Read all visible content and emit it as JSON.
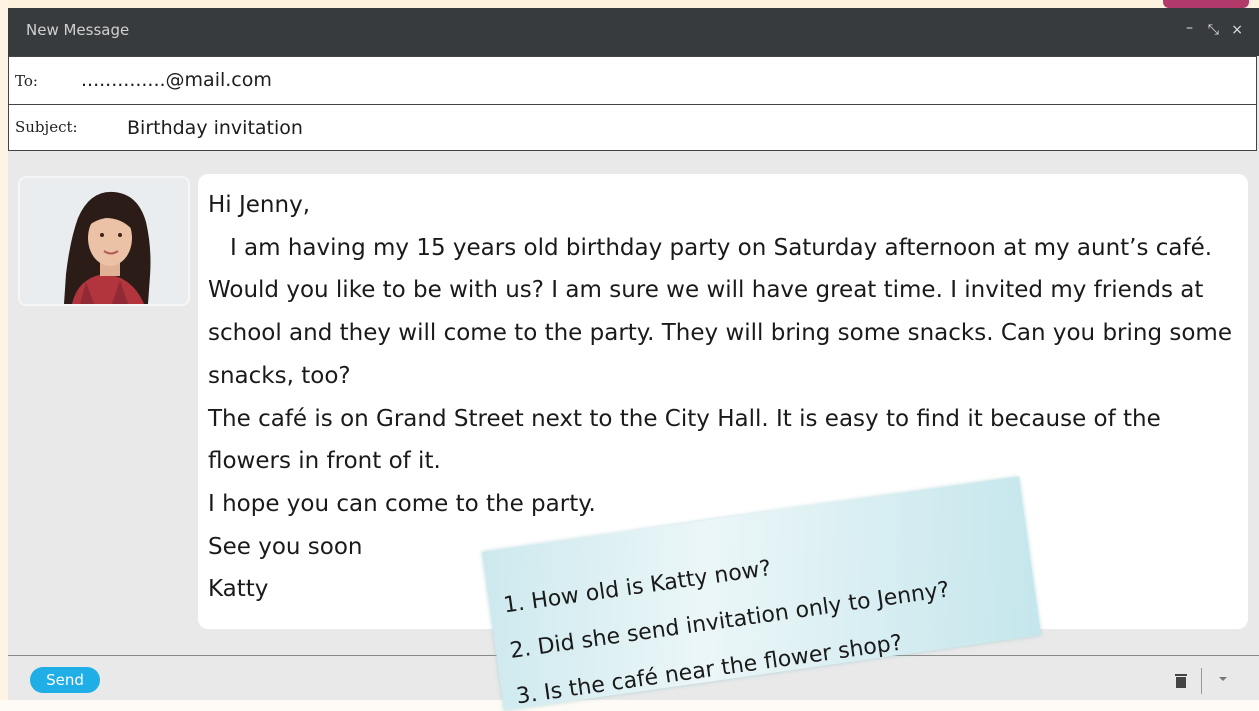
{
  "window": {
    "title": "New Message",
    "controls": {
      "minimize": "–",
      "expand": "⤡",
      "close": "×"
    }
  },
  "to": {
    "label": "To:",
    "value": "..............@mail.com"
  },
  "subject": {
    "label": "Subject:",
    "value": "Birthday invitation"
  },
  "body": {
    "lines": [
      "Hi Jenny,",
      "   I am having my 15 years old birthday party on Saturday afternoon at my aunt’s café. Would you like to be with us? I am sure we will have great time. I invited my friends at school and they will come to the party. They will bring some snacks. Can you bring some snacks, too?",
      "The café is on Grand Street next to the City Hall. It is easy to find it because of the flowers in front of it.",
      "I hope you can come to the party.",
      "See you soon",
      "Katty"
    ]
  },
  "note": {
    "questions": [
      "1. How old is Katty now?",
      "2. Did she send invitation only to Jenny?",
      "3. Is the café near the flower shop?"
    ]
  },
  "toolbar": {
    "send_label": "Send",
    "trash_icon": "trash-icon",
    "more_icon": "chevron-down-icon"
  },
  "colors": {
    "titlebar": "#383b3e",
    "send": "#1faee6",
    "accent_tab": "#b23a6a",
    "note": "#d3edf1"
  }
}
